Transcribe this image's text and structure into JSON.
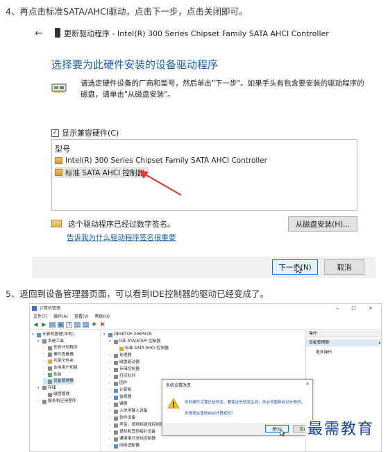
{
  "step4_text": "4、再点击标准SATA/AHCI驱动，点击下一步，点击关闭即可。",
  "step5_text": "5、返回到设备管理器页面，可以看到IDE控制器的驱动已经变成了。",
  "dialog": {
    "back_glyph": "←",
    "title": "更新驱动程序 - Intel(R) 300 Series Chipset Family SATA AHCI Controller",
    "heading": "选择要为此硬件安装的设备驱动程序",
    "description": "请选定硬件设备的厂商和型号，然后单击\"下一步\"。如果手头有包含要安装的驱动程序的磁盘，请单击\"从磁盘安装\"。",
    "compatible_checkbox_label": "显示兼容硬件(C)",
    "compatible_checked": true,
    "check_glyph": "✓",
    "model_header": "型号",
    "models": [
      "Intel(R) 300 Series Chipset Family SATA AHCI Controller",
      "标准 SATA AHCI 控制器"
    ],
    "selected_model_index": 1,
    "signed_text": "这个驱动程序已经过数字签名。",
    "signing_link": "告诉我为什么驱动程序签名很重要",
    "disk_button": "从磁盘安装(H)...",
    "next_button": "下一步(N)",
    "cancel_button": "取消",
    "arrow_color": "#e53935",
    "heading_color": "#1a5fa8"
  },
  "devmgr": {
    "window_title": "计算机管理",
    "window_controls": "– □ ×",
    "menu": [
      "文件(F)",
      "操作(A)",
      "查看(V)",
      "帮助(H)"
    ],
    "toolbar_glyphs": [
      "◀",
      "▶",
      "▤",
      "▦",
      "?",
      "▥",
      "▧",
      "✚",
      "✖"
    ],
    "left_tree": [
      {
        "label": "计算机管理(本地)",
        "indent": 0,
        "icon": "blue",
        "exp": "▾"
      },
      {
        "label": "系统工具",
        "indent": 1,
        "icon": "gray",
        "exp": "▾"
      },
      {
        "label": "任务计划程序",
        "indent": 2,
        "icon": "gray",
        "exp": "›"
      },
      {
        "label": "事件查看器",
        "indent": 2,
        "icon": "gray",
        "exp": "›"
      },
      {
        "label": "共享文件夹",
        "indent": 2,
        "icon": "yellow",
        "exp": "›"
      },
      {
        "label": "本地用户和组",
        "indent": 2,
        "icon": "gray",
        "exp": "›"
      },
      {
        "label": "性能",
        "indent": 2,
        "icon": "green",
        "exp": "›"
      },
      {
        "label": "设备管理器",
        "indent": 2,
        "icon": "gray",
        "exp": "",
        "selected": true
      },
      {
        "label": "存储",
        "indent": 1,
        "icon": "gray",
        "exp": "▾"
      },
      {
        "label": "磁盘管理",
        "indent": 2,
        "icon": "gray",
        "exp": ""
      },
      {
        "label": "服务和应用程序",
        "indent": 1,
        "icon": "gray",
        "exp": "›"
      }
    ],
    "device_tree": [
      {
        "label": "DESKTOP-29KP41R",
        "indent": 0,
        "icon": "blue",
        "exp": "▾"
      },
      {
        "label": "IDE ATA/ATAPI 控制器",
        "indent": 1,
        "icon": "gray",
        "exp": "▾"
      },
      {
        "label": "标准 SATA AHCI 控制器",
        "indent": 2,
        "icon": "yellow",
        "exp": ""
      },
      {
        "label": "处理器",
        "indent": 1,
        "icon": "gray",
        "exp": "›"
      },
      {
        "label": "磁盘驱动器",
        "indent": 1,
        "icon": "gray",
        "exp": "›"
      },
      {
        "label": "存储控制器",
        "indent": 1,
        "icon": "gray",
        "exp": "›"
      },
      {
        "label": "打印队列",
        "indent": 1,
        "icon": "gray",
        "exp": "›"
      },
      {
        "label": "固件",
        "indent": 1,
        "icon": "gray",
        "exp": "›"
      },
      {
        "label": "计算机",
        "indent": 1,
        "icon": "blue",
        "exp": "›"
      },
      {
        "label": "监视器",
        "indent": 1,
        "icon": "blue",
        "exp": "›"
      },
      {
        "label": "键盘",
        "indent": 1,
        "icon": "gray",
        "exp": "›"
      },
      {
        "label": "人体学输入设备",
        "indent": 1,
        "icon": "gray",
        "exp": "›"
      },
      {
        "label": "软件设备",
        "indent": 1,
        "icon": "gray",
        "exp": "›"
      },
      {
        "label": "声音、视频和游戏控制器",
        "indent": 1,
        "icon": "gray",
        "exp": "›"
      },
      {
        "label": "鼠标和其他指针设备",
        "indent": 1,
        "icon": "gray",
        "exp": "›"
      },
      {
        "label": "通用串行总线控制器",
        "indent": 1,
        "icon": "gray",
        "exp": "›"
      },
      {
        "label": "网络适配器",
        "indent": 1,
        "icon": "blue",
        "exp": "›"
      }
    ],
    "actions_header": "操作",
    "actions_sub": "设备管理器",
    "actions_caret": "▴",
    "actions_item": "更多操作",
    "modal": {
      "title": "系统设置改变",
      "close_glyph": "×",
      "message1": "你的硬件设置已经改变。要使这些改变生效，你必须重新启动计算机。",
      "message2": "你想现在重新启动计算机吗？",
      "yes_button": "是(Y)",
      "no_button": "否(N)"
    }
  },
  "watermark": "最需教育"
}
